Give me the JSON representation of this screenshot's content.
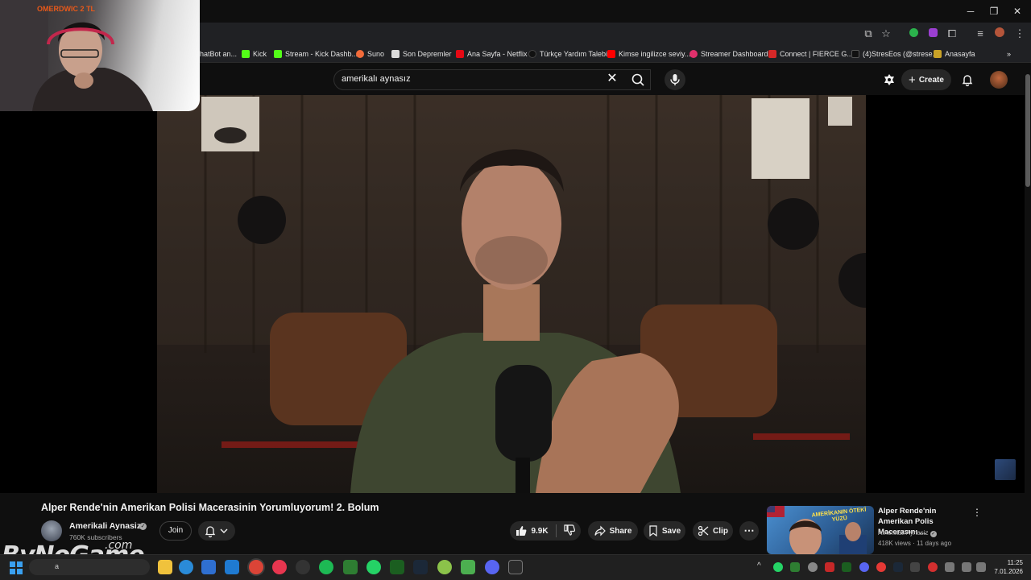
{
  "browser": {
    "bookmarks": [
      {
        "label": "hatBot an...",
        "icon": "chatbot-favicon",
        "color": "#1f1f1f"
      },
      {
        "label": "Kick",
        "icon": "kick-favicon",
        "color": "#53fc18"
      },
      {
        "label": "Stream - Kick Dashb...",
        "icon": "kick-favicon",
        "color": "#53fc18"
      },
      {
        "label": "Suno",
        "icon": "suno-favicon",
        "color": "#f26b3a"
      },
      {
        "label": "Son Depremler",
        "icon": "depremler-favicon",
        "color": "#dcdcdc"
      },
      {
        "label": "Ana Sayfa - Netflix",
        "icon": "netflix-favicon",
        "color": "#e50914"
      },
      {
        "label": "Türkçe Yardım Talebi",
        "icon": "help-favicon",
        "color": "#111111"
      },
      {
        "label": "Kimse ingilizce seviy...",
        "icon": "youtube-favicon",
        "color": "#ff0000"
      },
      {
        "label": "Streamer Dashboard",
        "icon": "dashboard-favicon",
        "color": "#e1306c"
      },
      {
        "label": "Connect | FIERCE G...",
        "icon": "fierce-favicon",
        "color": "#d62828"
      },
      {
        "label": "(4)StresEos (@strese...",
        "icon": "tiktok-favicon",
        "color": "#111111"
      },
      {
        "label": "Anasayfa",
        "icon": "home-favicon",
        "color": "#c9a227"
      }
    ]
  },
  "webcam": {
    "caption": "OMERDWIC 2 TL"
  },
  "youtube": {
    "search_value": "amerikalı aynasız",
    "create_label": "Create",
    "video_title": "Alper Rende'nin Amerikan Polisi Macerasinin Yorumluyorum! 2. Bolum",
    "channel_name": "Amerikali Aynasiz",
    "subscribers": "760K subscribers",
    "join_label": "Join",
    "likes": "9.9K",
    "share_label": "Share",
    "save_label": "Save",
    "clip_label": "Clip",
    "recommended": {
      "title": "Alper Rende'nin Amerikan Polis Macerasını ...",
      "channel": "Amerikali Aynasiz",
      "meta": "418K views · 11 days ago",
      "thumb_text": "AMERİKANIN ÖTEKİ YÜZÜ"
    }
  },
  "watermark": {
    "main": "ByNoGame",
    "suffix": ".com"
  },
  "taskbar": {
    "time": "11:25",
    "date": "7.01.2026",
    "search_placeholder": "a"
  },
  "colors": {
    "accent": "#ff0000",
    "bg": "#0f0f0f"
  }
}
